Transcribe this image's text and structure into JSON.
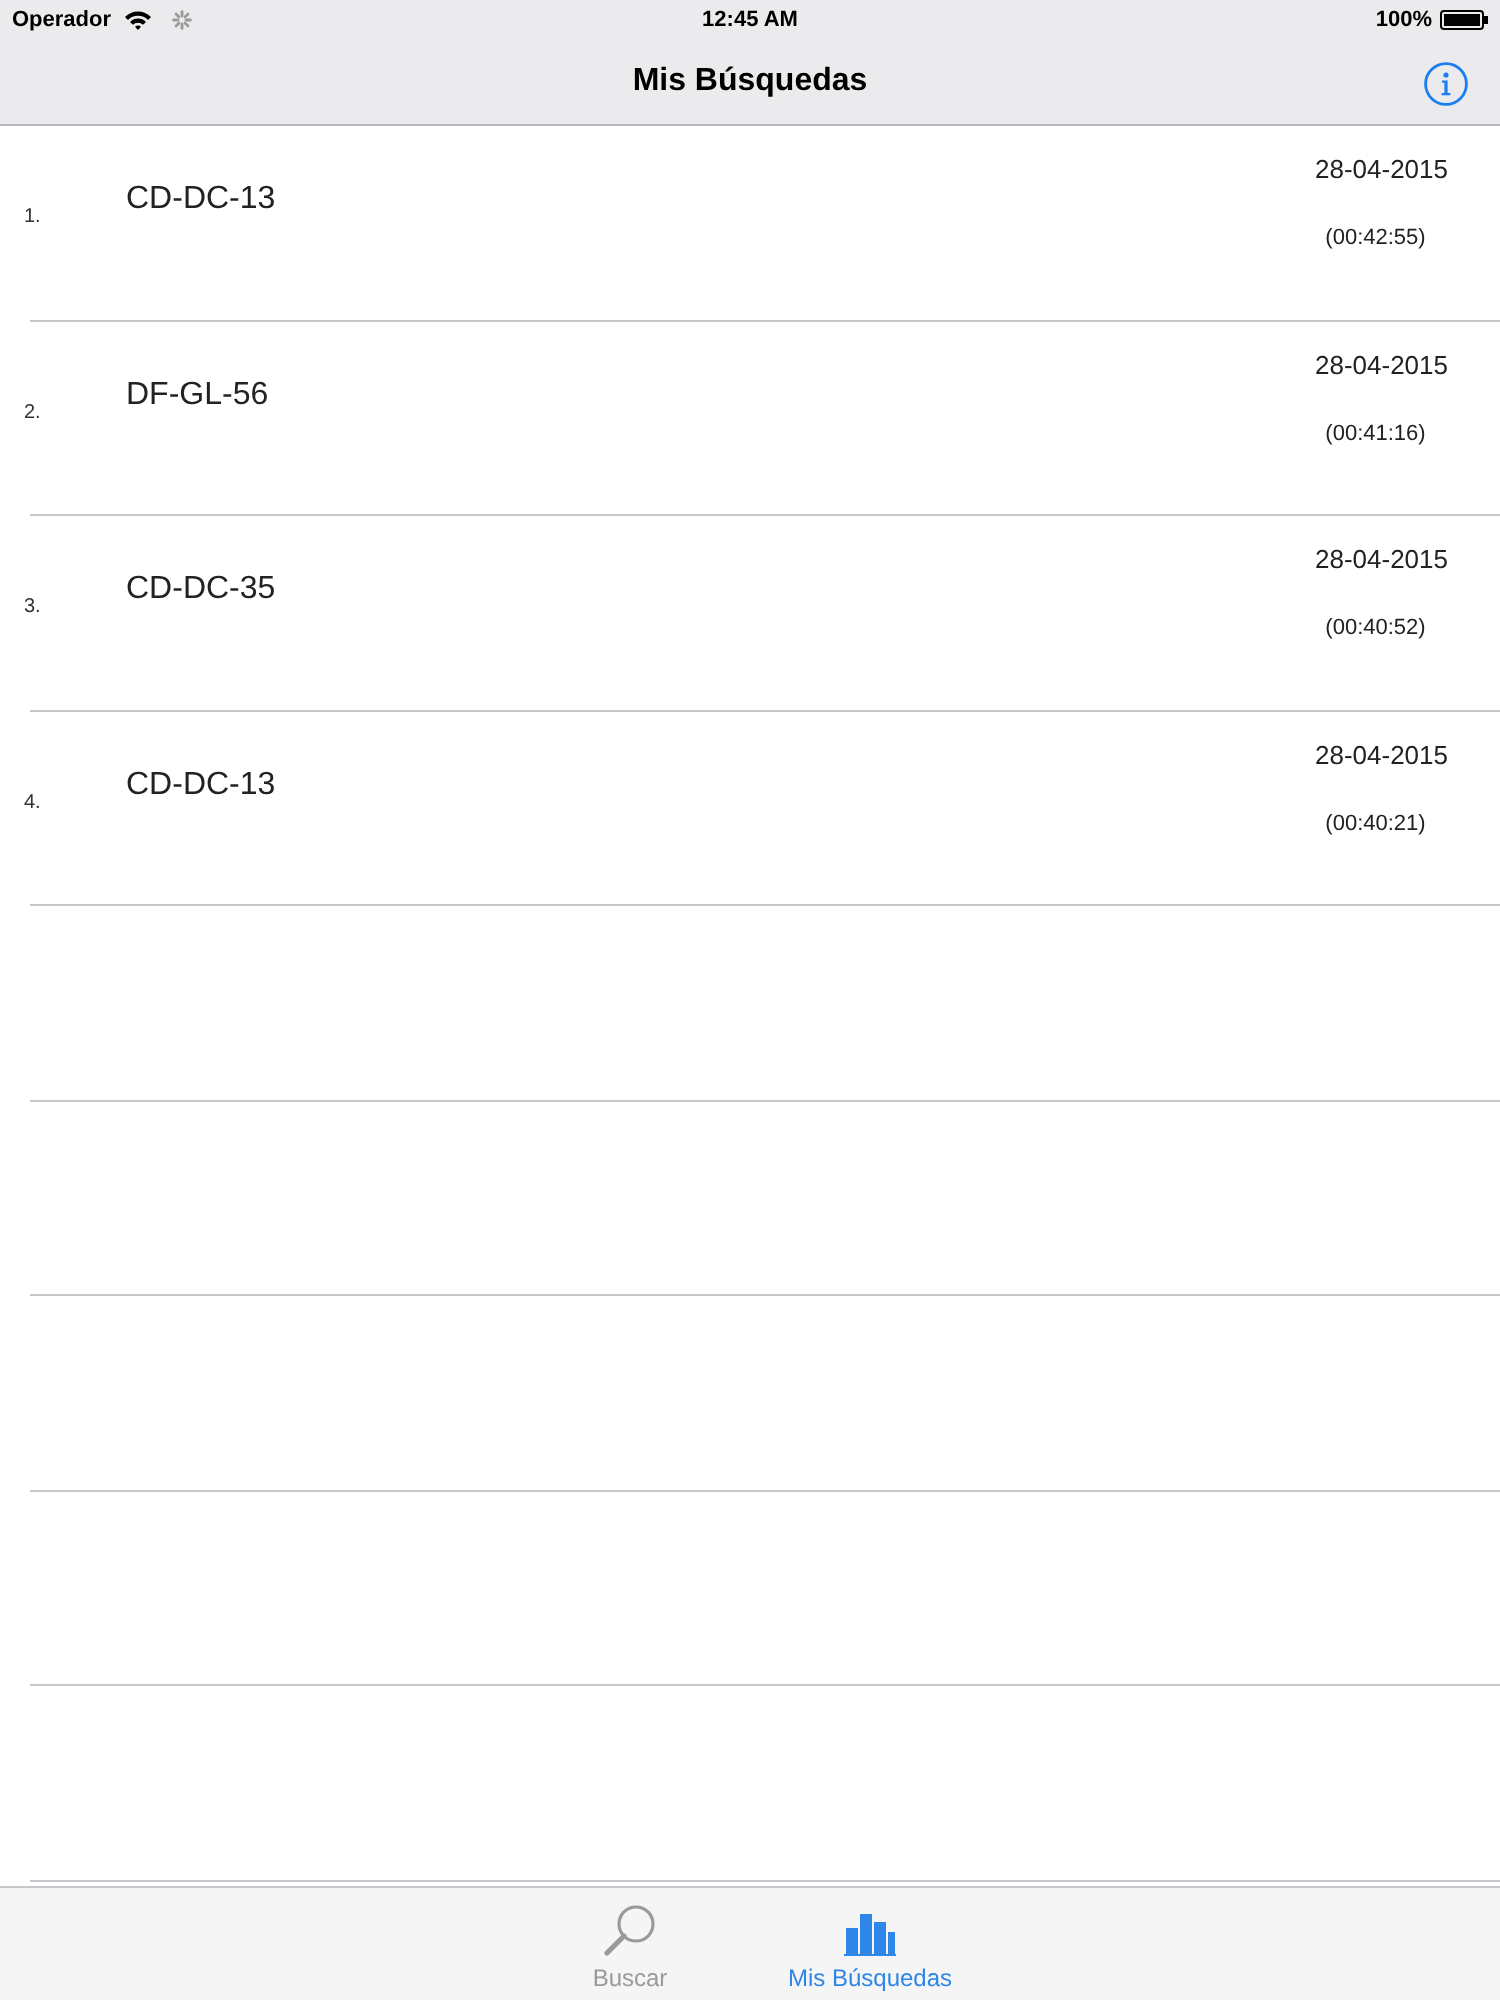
{
  "status_bar": {
    "carrier": "Operador",
    "time": "12:45 AM",
    "battery": "100%"
  },
  "nav_bar": {
    "title": "Mis Búsquedas"
  },
  "searches": [
    {
      "number": "1.",
      "plate": "CD-DC-13",
      "date": "28-04-2015",
      "time": "(00:42:55)"
    },
    {
      "number": "2.",
      "plate": "DF-GL-56",
      "date": "28-04-2015",
      "time": "(00:41:16)"
    },
    {
      "number": "3.",
      "plate": "CD-DC-35",
      "date": "28-04-2015",
      "time": "(00:40:52)"
    },
    {
      "number": "4.",
      "plate": "CD-DC-13",
      "date": "28-04-2015",
      "time": "(00:40:21)"
    }
  ],
  "tab_bar": {
    "tabs": [
      {
        "label": "Buscar",
        "kind": "search",
        "selected": false
      },
      {
        "label": "Mis Búsquedas",
        "kind": "chart",
        "selected": true
      }
    ]
  }
}
